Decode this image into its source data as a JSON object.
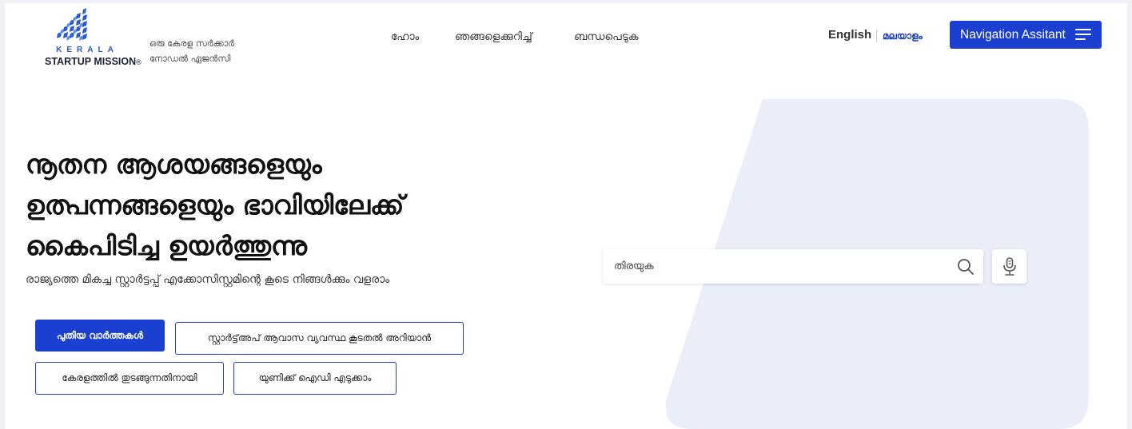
{
  "header": {
    "logo": {
      "kerala": "KERALA",
      "name": "STARTUP MISSION",
      "reg": "®",
      "brand_color": "#2b58c9"
    },
    "tagline": {
      "line1": "ഒരു കേരള സർക്കാർ",
      "line2": "നോഡൽ ഏജൻസി"
    },
    "nav": [
      {
        "label": "ഹോം"
      },
      {
        "label": "ഞങ്ങളെക്കുറിച്ച്"
      },
      {
        "label": "ബന്ധപെടുക"
      }
    ],
    "lang": {
      "english": "English",
      "malayalam": "മലയാളം"
    },
    "nav_assistant": {
      "label": "Navigation Assitant",
      "icon": "menu-icon"
    }
  },
  "hero": {
    "title_lines": [
      "നൂതന ആശയങ്ങളെയും",
      "ഉത്പന്നങ്ങളെയും ഭാവിയിലേക്ക്",
      "കൈപിടിച്ച ഉയർത്തുന്നു"
    ],
    "subtitle": "രാജ്യത്തെ മികച്ച സ്റ്റാർട്ടപ്പ് എക്കോസിസ്റ്റമിന്റെ കൂടെ നിങ്ങൾക്കും വളരാം",
    "buttons": {
      "news": "പുതിയ വാർത്തകൾ",
      "housing": "സ്റ്റാർട്ട്അപ് ആവാസ വ്യവസ്ഥ കൂടതൽ അറിയാൻ",
      "start_kerala": "കേരളത്തിൽ തുടങ്ങുന്നതിനായി",
      "unique_id": "യുണിക്ക് ഐഡി എടുക്കാം"
    }
  },
  "search": {
    "placeholder": "തിരയുക",
    "search_icon": "search-icon",
    "mic_icon": "microphone-icon"
  },
  "colors": {
    "accent": "#1a3fd1",
    "panel": "#e9eef8"
  }
}
